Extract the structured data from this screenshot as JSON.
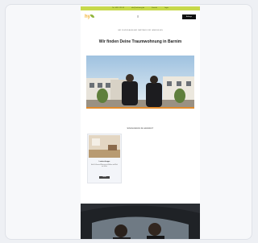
{
  "topbar": {
    "items": [
      "Tel. 0351 123 45",
      "info@wohnung.de",
      "Kontakt",
      "Login"
    ]
  },
  "header": {
    "logo_text": "hy",
    "menu_icon": "hamburger-icon",
    "cta_label": "Anfrage"
  },
  "hero": {
    "kicker": "IHR ZUVERLÄSSIGER PARTNER FÜR IMMOBILIEN",
    "title": "Wir finden Deine Traumwohnung in Barnim",
    "image": "two-agents-walking-photo"
  },
  "listings": {
    "section_label": "WOHNUNGEN IM ANGEBOT",
    "items": [
      {
        "title": "Lewisschuppe",
        "description": "Helle 3-Zimmer-Wohnung mit Balkon und Blick ins Grüne",
        "button": "Details"
      }
    ]
  },
  "bottom": {
    "image": "car-interior-photo"
  },
  "colors": {
    "accent_bar": "#c7d94a",
    "hero_line": "#e08a2c",
    "button_dark": "#111111"
  }
}
